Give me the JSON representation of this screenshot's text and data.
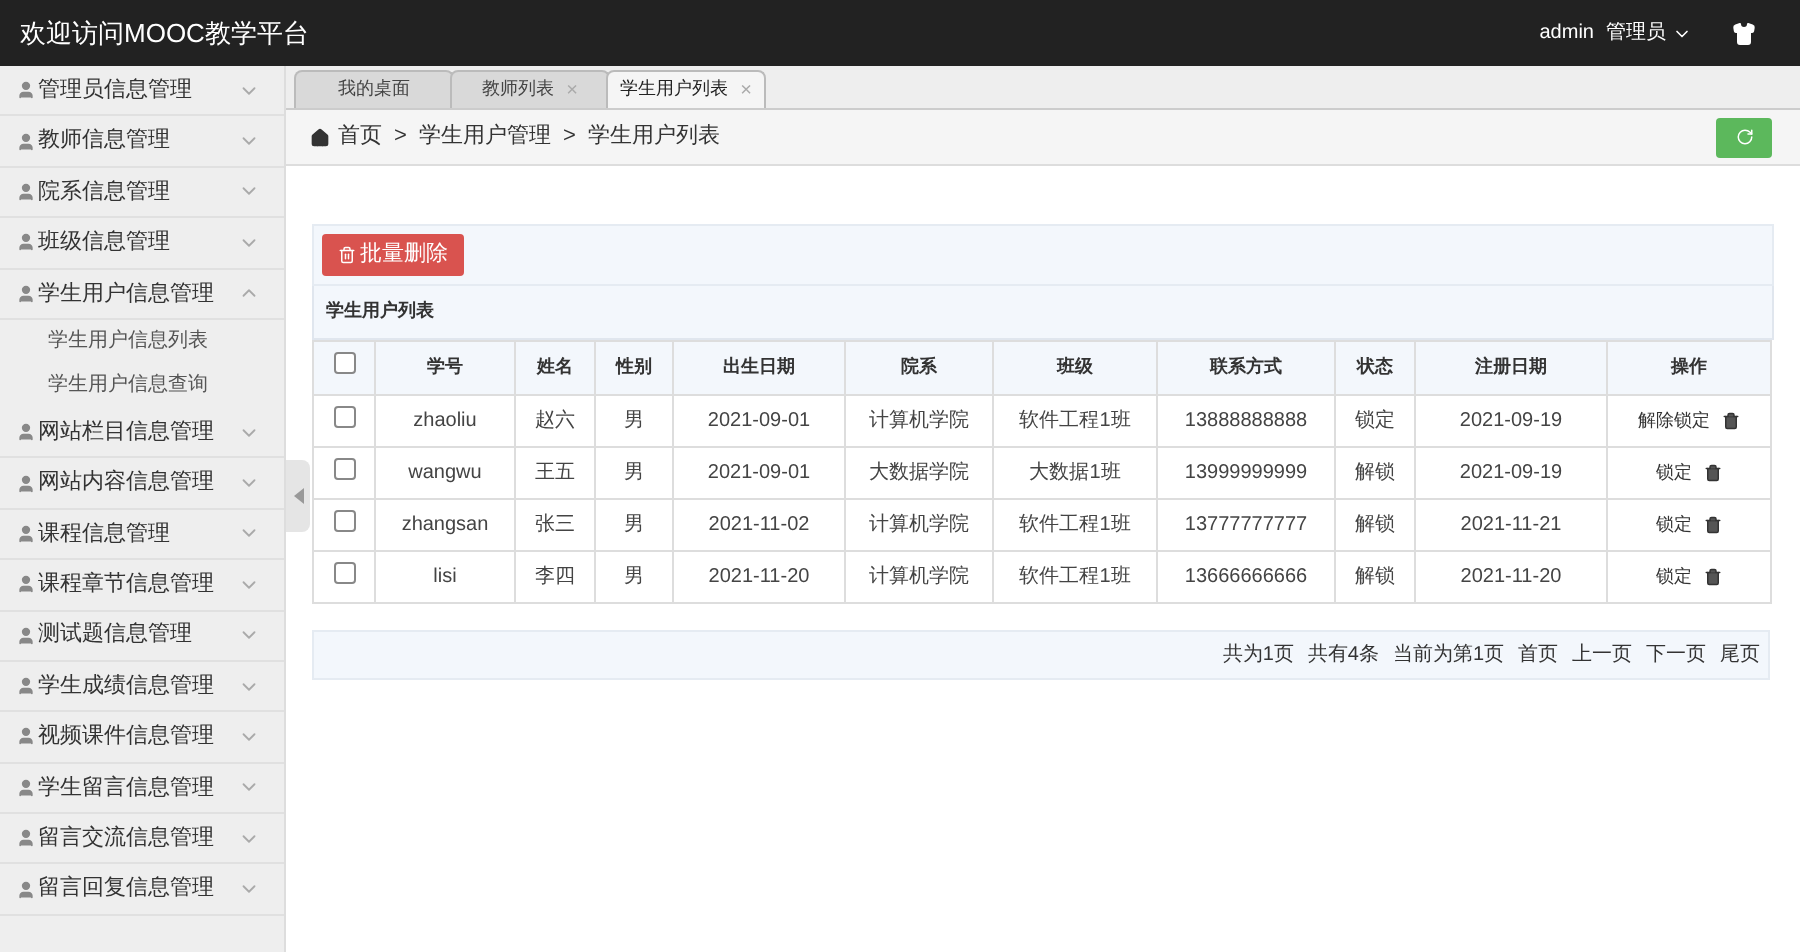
{
  "header": {
    "title": "欢迎访问MOOC教学平台",
    "user": "admin",
    "role": "管理员"
  },
  "sidebar": {
    "items": [
      {
        "label": "管理员信息管理",
        "expanded": false
      },
      {
        "label": "教师信息管理",
        "expanded": false
      },
      {
        "label": "院系信息管理",
        "expanded": false
      },
      {
        "label": "班级信息管理",
        "expanded": false
      },
      {
        "label": "学生用户信息管理",
        "expanded": true,
        "children": [
          {
            "label": "学生用户信息列表"
          },
          {
            "label": "学生用户信息查询"
          }
        ]
      },
      {
        "label": "网站栏目信息管理",
        "expanded": false
      },
      {
        "label": "网站内容信息管理",
        "expanded": false
      },
      {
        "label": "课程信息管理",
        "expanded": false
      },
      {
        "label": "课程章节信息管理",
        "expanded": false
      },
      {
        "label": "测试题信息管理",
        "expanded": false
      },
      {
        "label": "学生成绩信息管理",
        "expanded": false
      },
      {
        "label": "视频课件信息管理",
        "expanded": false
      },
      {
        "label": "学生留言信息管理",
        "expanded": false
      },
      {
        "label": "留言交流信息管理",
        "expanded": false
      },
      {
        "label": "留言回复信息管理",
        "expanded": false
      }
    ]
  },
  "tabs": [
    {
      "label": "我的桌面",
      "selected": false,
      "closable": false
    },
    {
      "label": "教师列表",
      "selected": false,
      "closable": true
    },
    {
      "label": "学生用户列表",
      "selected": true,
      "closable": true
    }
  ],
  "close_glyph": "×",
  "breadcrumb": [
    "首页",
    "学生用户管理",
    "学生用户列表"
  ],
  "breadcrumb_separator": ">",
  "batch_delete": "批量删除",
  "table": {
    "title": "学生用户列表",
    "header_checked": false,
    "columns": [
      "学号",
      "姓名",
      "性别",
      "出生日期",
      "院系",
      "班级",
      "联系方式",
      "状态",
      "注册日期",
      "操作"
    ],
    "rows": [
      {
        "checked": false,
        "cells": [
          "zhaoliu",
          "赵六",
          "男",
          "2021-09-01",
          "计算机学院",
          "软件工程1班",
          "13888888888",
          "锁定",
          "2021-09-19"
        ],
        "action": "解除锁定"
      },
      {
        "checked": false,
        "cells": [
          "wangwu",
          "王五",
          "男",
          "2021-09-01",
          "大数据学院",
          "大数据1班",
          "13999999999",
          "解锁",
          "2021-09-19"
        ],
        "action": "锁定"
      },
      {
        "checked": false,
        "cells": [
          "zhangsan",
          "张三",
          "男",
          "2021-11-02",
          "计算机学院",
          "软件工程1班",
          "13777777777",
          "解锁",
          "2021-11-21"
        ],
        "action": "锁定"
      },
      {
        "checked": false,
        "cells": [
          "lisi",
          "李四",
          "男",
          "2021-11-20",
          "计算机学院",
          "软件工程1班",
          "13666666666",
          "解锁",
          "2021-11-20"
        ],
        "action": "锁定"
      }
    ]
  },
  "pagination": {
    "info": [
      "共为1页",
      "共有4条",
      "当前为第1页"
    ],
    "links": [
      "首页",
      "上一页",
      "下一页",
      "尾页"
    ]
  }
}
